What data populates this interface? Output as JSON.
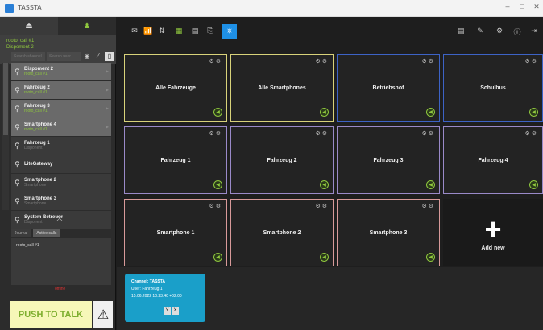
{
  "window": {
    "title": "TASSTA",
    "controls": [
      "–",
      "□",
      "✕"
    ]
  },
  "sidebar": {
    "tabs": [
      {
        "icon": "channels-icon",
        "glyph": "⏏"
      },
      {
        "icon": "user-icon",
        "glyph": "♟"
      }
    ],
    "user": {
      "line1": "rooto_call #1",
      "line2": "Dispoment 2"
    },
    "search_channel_placeholder": "Search channel",
    "search_user_placeholder": "Search user",
    "channels": [
      {
        "name": "Dispoment 2",
        "sub": "rooto_call #1",
        "state": "sel"
      },
      {
        "name": "Fahrzeug 2",
        "sub": "rooto_call #1",
        "state": "sel"
      },
      {
        "name": "Fahrzeug 3",
        "sub": "rooto_call #1",
        "state": "sel"
      },
      {
        "name": "Smartphone 4",
        "sub": "rooto_call #1",
        "state": "sel"
      },
      {
        "name": "Fahrzeug 1",
        "sub": "Disponent",
        "state": "norm"
      },
      {
        "name": "LiteGateway",
        "sub": "",
        "state": "norm"
      },
      {
        "name": "Smartphone 2",
        "sub": "Smartphone",
        "state": "norm"
      },
      {
        "name": "Smartphone 3",
        "sub": "Smartphone",
        "state": "norm"
      },
      {
        "name": "System Betreuer",
        "sub": "Disponent",
        "state": "norm"
      }
    ],
    "subtabs": [
      "Journal",
      "Active calls"
    ],
    "log_text": "rooto_call #1",
    "status_text": "offline",
    "ptt_label": "PUSH TO TALK",
    "warn_glyph": "⚠"
  },
  "toolbar": {
    "left_buttons": [
      {
        "icon": "messages-icon",
        "glyph": "✉"
      },
      {
        "icon": "radio-icon",
        "glyph": "📶"
      },
      {
        "icon": "transfer-icon",
        "glyph": "⇅"
      },
      {
        "icon": "grid-icon",
        "glyph": "▦"
      },
      {
        "icon": "document-icon",
        "glyph": "▤"
      },
      {
        "icon": "export-icon",
        "glyph": "⎘"
      },
      {
        "icon": "dispatch-icon",
        "glyph": "⎈"
      }
    ],
    "right_buttons": [
      {
        "icon": "journal-icon",
        "glyph": "▤"
      },
      {
        "icon": "edit-icon",
        "glyph": "✎"
      },
      {
        "icon": "settings-icon",
        "glyph": "⚙"
      },
      {
        "icon": "info-icon",
        "glyph": "ⓘ"
      },
      {
        "icon": "logout-icon",
        "glyph": "⇥"
      }
    ]
  },
  "tiles": [
    {
      "name": "Alle Fahrzeuge",
      "border": "yellow"
    },
    {
      "name": "Alle Smartphones",
      "border": "yellow"
    },
    {
      "name": "Betriebshof",
      "border": "blue"
    },
    {
      "name": "Schulbus",
      "border": "blue"
    },
    {
      "name": "Fahrzeug 1",
      "border": "purple"
    },
    {
      "name": "Fahrzeug 2",
      "border": "purple"
    },
    {
      "name": "Fahrzeug 3",
      "border": "purple"
    },
    {
      "name": "Fahrzeug 4",
      "border": "purple"
    },
    {
      "name": "Smartphone 1",
      "border": "pink"
    },
    {
      "name": "Smartphone 2",
      "border": "pink"
    },
    {
      "name": "Smartphone 3",
      "border": "pink"
    }
  ],
  "add_new": {
    "label": "Add new"
  },
  "call_card": {
    "channel": "Channel: TASSTA",
    "user": "User: Fahrzeug 1",
    "time": "15.06.2022 10:23:40 +02:00",
    "buttons": [
      "Y",
      "X"
    ]
  },
  "colors": {
    "accent_green": "#8fc73e",
    "active_blue": "#1e90e6",
    "card_cyan": "#1a9fc9",
    "ptt_bg": "#f6f7b8"
  }
}
